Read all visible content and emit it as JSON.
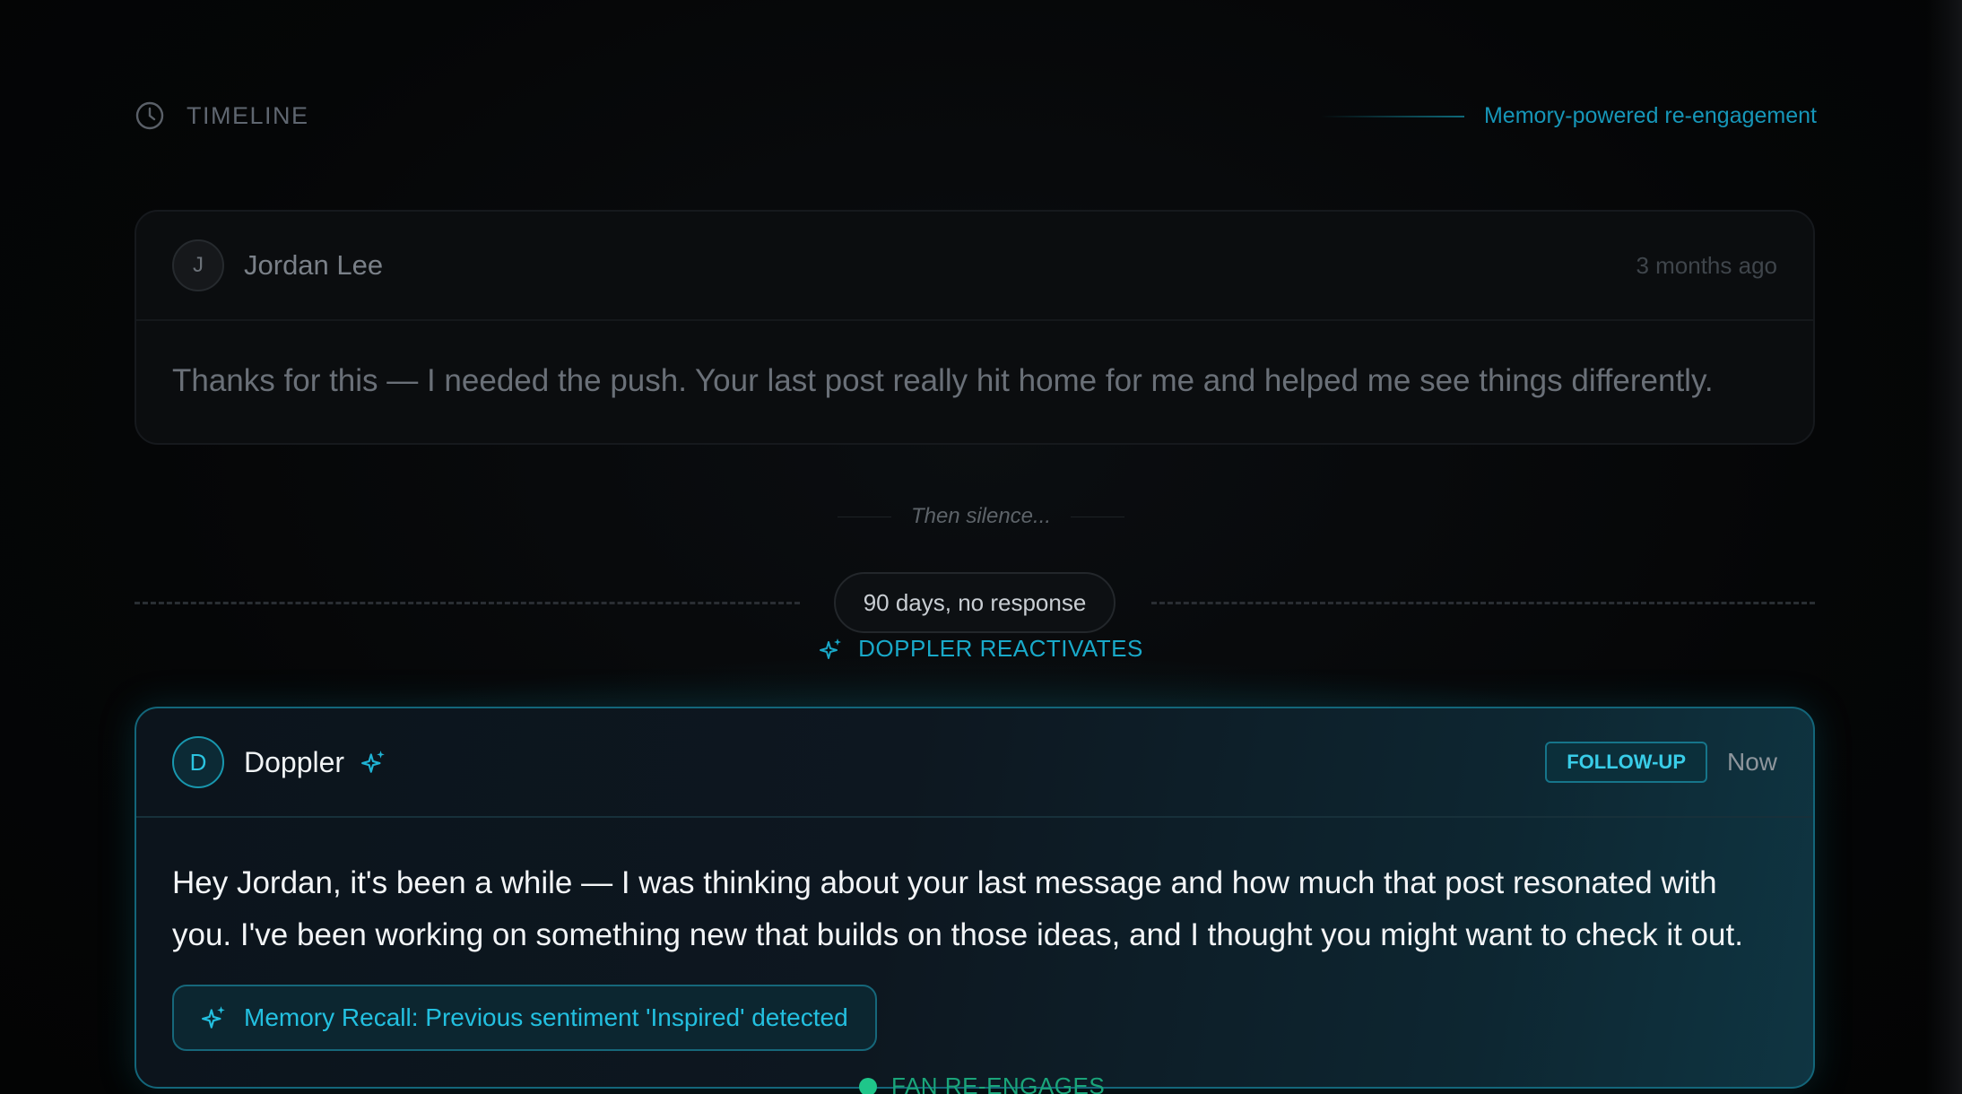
{
  "header": {
    "title": "TIMELINE",
    "icon": "clock-icon",
    "tagline": "Memory-powered re-engagement"
  },
  "past_message": {
    "avatar_initial": "J",
    "sender": "Jordan Lee",
    "time": "3 months ago",
    "text": "Thanks for this — I needed the push. Your last post really hit home for me and helped me see things differently."
  },
  "gap": {
    "caption": "Then silence...",
    "duration_pill": "90 days, no response"
  },
  "reactivation": {
    "label": "DOPPLER REACTIVATES",
    "icon": "sparkle-icon"
  },
  "followup_message": {
    "avatar_initial": "D",
    "sender": "Doppler",
    "badge": "FOLLOW-UP",
    "time": "Now",
    "text": "Hey Jordan, it's been a while — I was thinking about your last message and how much that post resonated with you. I've been working on something new that builds on those ideas, and I thought you might want to check it out.",
    "memory_recall": "Memory Recall: Previous sentiment 'Inspired' detected"
  },
  "next_step": {
    "label": "FAN RE-ENGAGES"
  },
  "colors": {
    "accent": "#19a9c9",
    "success": "#1fc68a",
    "background": "#050607"
  }
}
